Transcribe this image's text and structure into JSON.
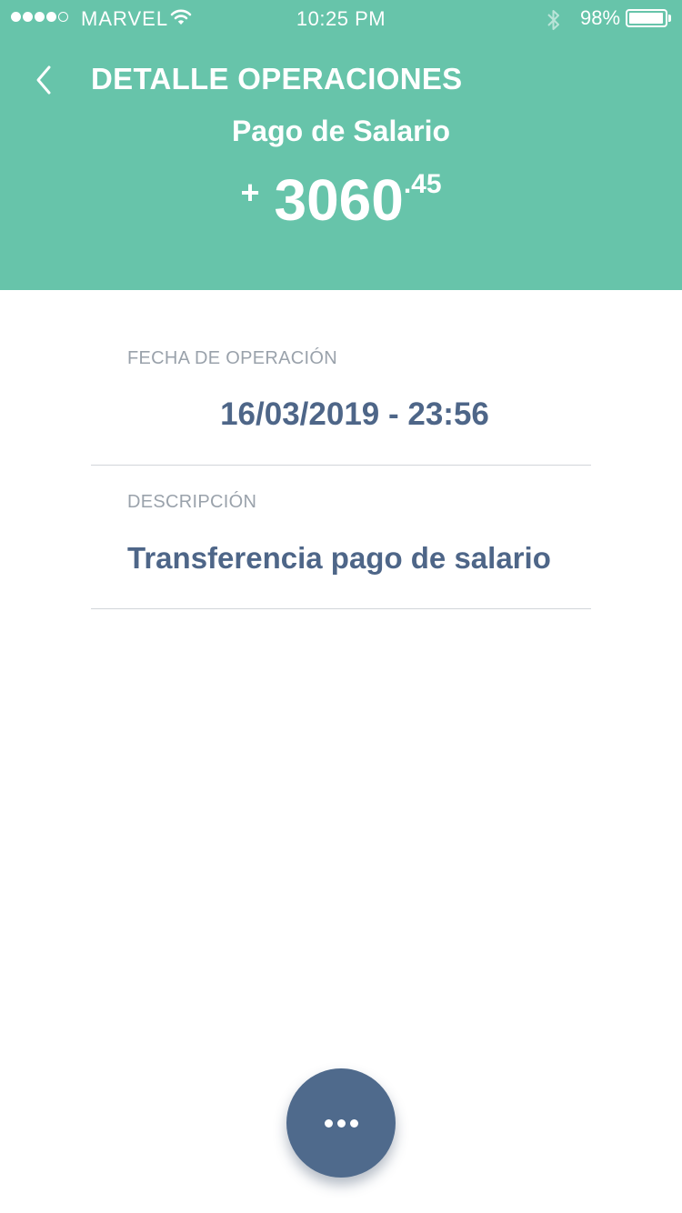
{
  "status_bar": {
    "carrier": "MARVEL",
    "time": "10:25 PM",
    "battery_percent": "98%",
    "signal_bars_filled": 4,
    "signal_bars_total": 5,
    "battery_level": 0.98
  },
  "header": {
    "back_icon": "chevron-left-icon",
    "title": "DETALLE OPERACIONES",
    "operation_name": "Pago de Salario",
    "amount": {
      "sign": "+",
      "integer": "3060",
      "decimal": ".45"
    }
  },
  "details": {
    "date_label": "FECHA DE OPERACIÓN",
    "date_value": "16/03/2019 - 23:56",
    "description_label": "DESCRIPCIÓN",
    "description_value": "Transferencia pago de salario"
  },
  "fab": {
    "icon": "more-dots-icon"
  },
  "colors": {
    "header_bg": "#67c4aa",
    "value_text": "#4e6688",
    "label_text": "#9aa2ab",
    "fab_bg": "#4f6a8c"
  }
}
